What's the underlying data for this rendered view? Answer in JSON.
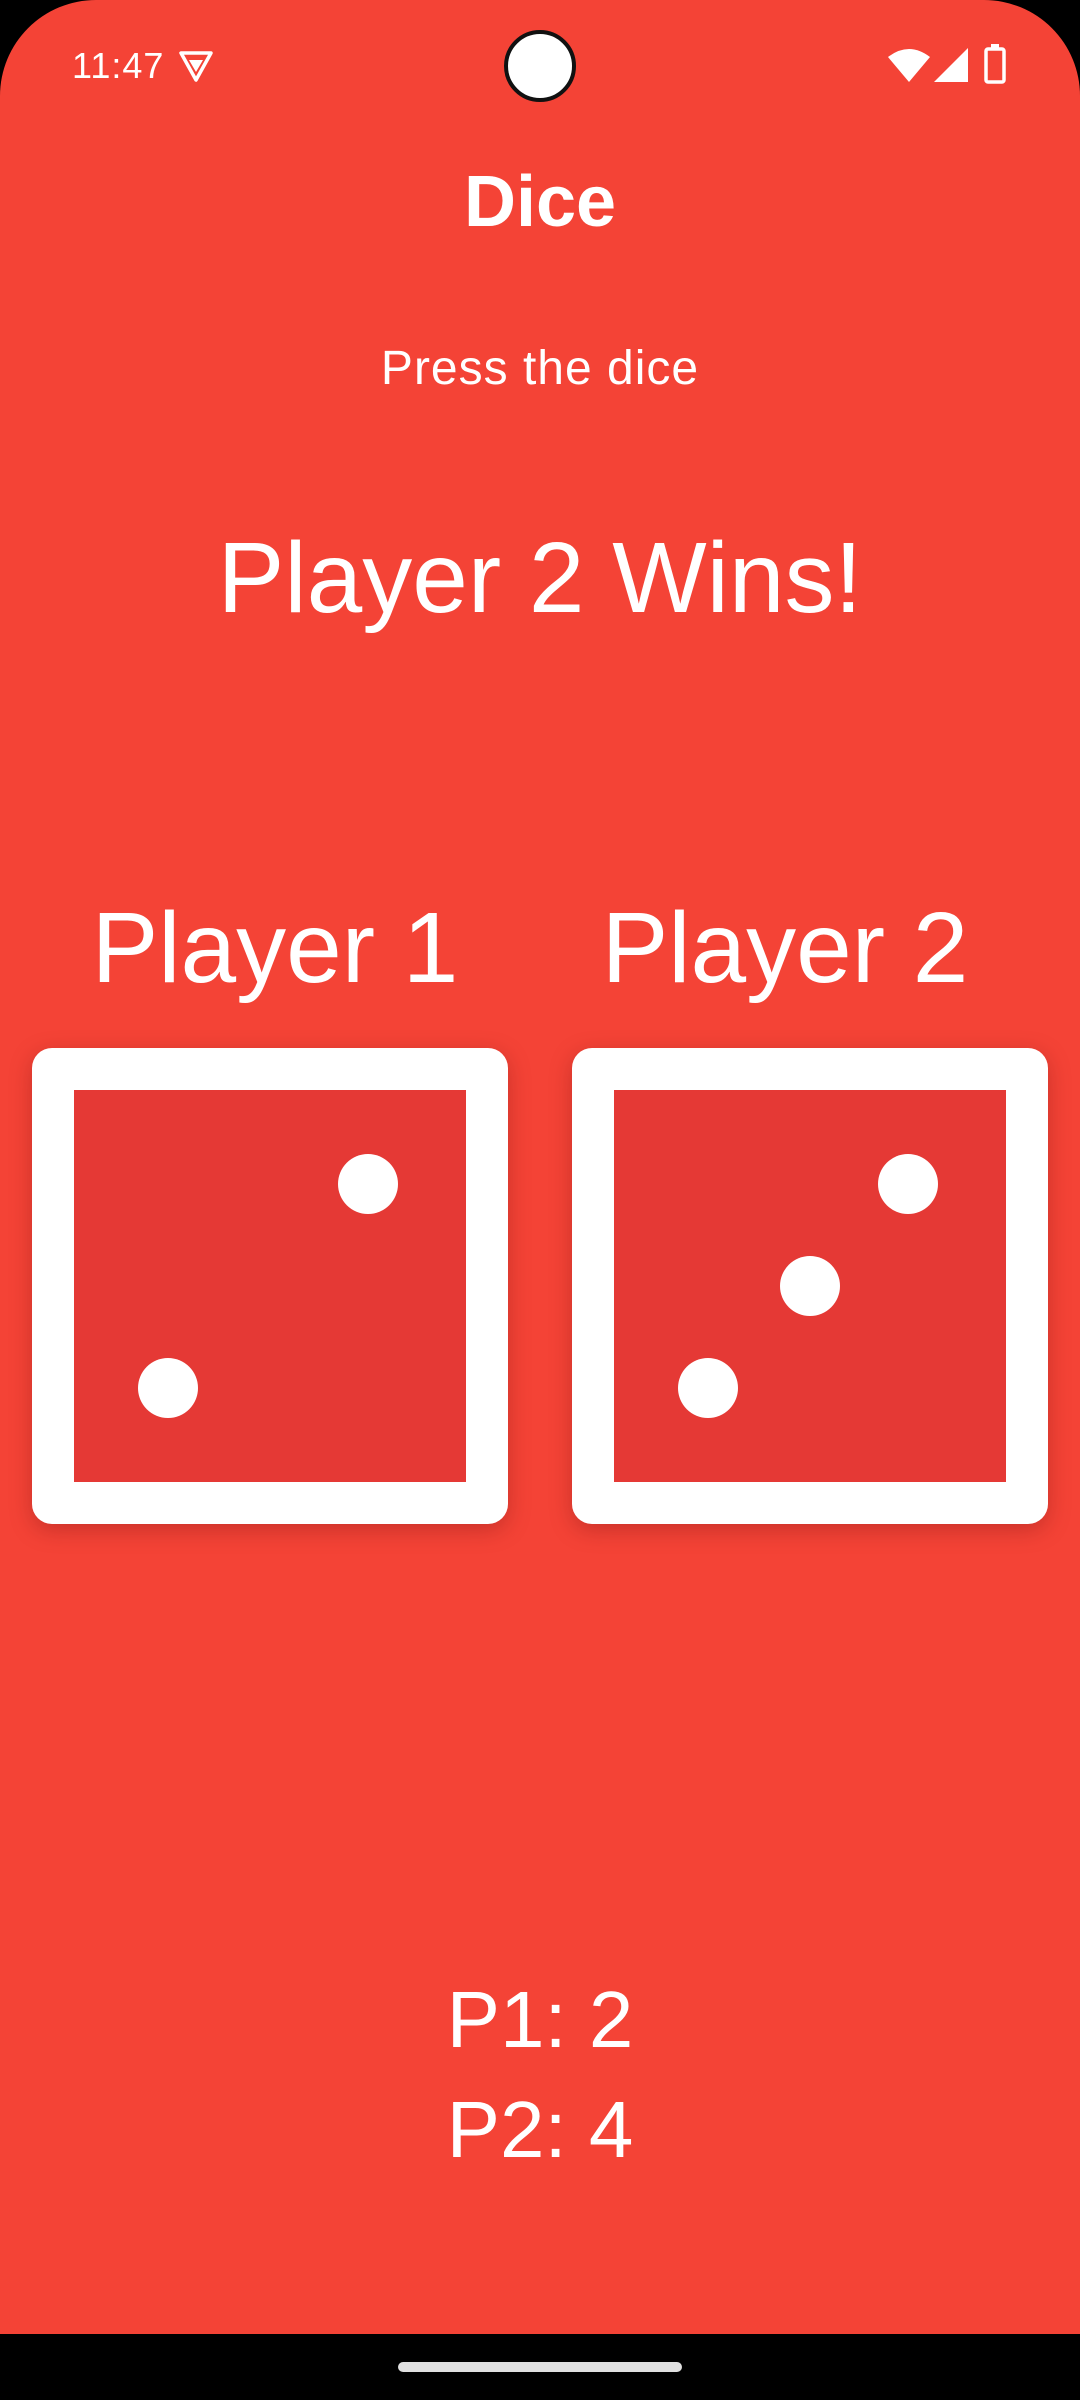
{
  "status_bar": {
    "time": "11:47",
    "icons": [
      "vpn-shield-icon",
      "wifi-icon",
      "cellular-signal-icon",
      "battery-icon"
    ]
  },
  "app": {
    "title": "Dice",
    "instruction": "Press the dice",
    "result": "Player 2 Wins!"
  },
  "players": [
    {
      "label": "Player 1",
      "die_value": 2,
      "score_label": "P1: 2"
    },
    {
      "label": "Player 2",
      "die_value": 3,
      "score_label": "P2: 4"
    }
  ],
  "colors": {
    "background": "#f44336",
    "die_face": "#e53935",
    "die_border": "#ffffff",
    "text": "#ffffff"
  }
}
